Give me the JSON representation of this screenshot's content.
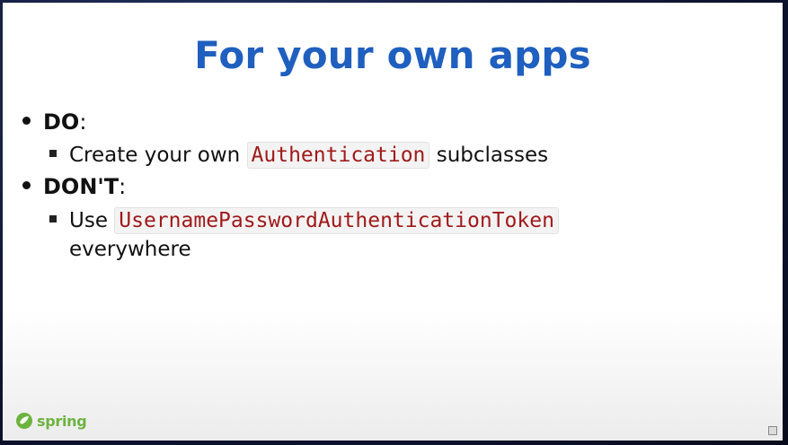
{
  "slide": {
    "title": "For your own apps",
    "bullets": [
      {
        "label": "DO",
        "suffix": ":",
        "sub": {
          "prefix": "Create your own",
          "code": "Authentication",
          "suffix": "subclasses"
        }
      },
      {
        "label": "DON'T",
        "suffix": ":",
        "sub": {
          "prefix": "Use",
          "code": "UsernamePasswordAuthenticationToken",
          "continuation": "everywhere"
        }
      }
    ]
  },
  "footer": {
    "logo_text": "spring",
    "logo_icon": "spring-leaf-icon"
  },
  "colors": {
    "title": "#1f5fbf",
    "code_text": "#a01a1a",
    "code_bg": "#f3f3f3",
    "logo": "#6db33f"
  }
}
